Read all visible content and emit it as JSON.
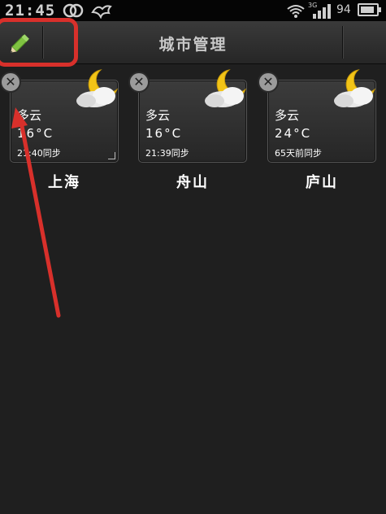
{
  "status_bar": {
    "time": "21:45",
    "network_label": "3G",
    "battery_level": "94",
    "icons": [
      "pair-of-rings-icon",
      "bird-icon",
      "wifi-icon",
      "signal-icon",
      "battery-icon"
    ]
  },
  "header": {
    "title": "城市管理",
    "edit_icon": "pencil-icon"
  },
  "cities": [
    {
      "name": "上海",
      "weather": "多云",
      "temp": "16°C",
      "sync": "21:40同步",
      "icon": "moon-cloud-icon"
    },
    {
      "name": "舟山",
      "weather": "多云",
      "temp": "16°C",
      "sync": "21:39同步",
      "icon": "moon-cloud-icon"
    },
    {
      "name": "庐山",
      "weather": "多云",
      "temp": "24°C",
      "sync": "65天前同步",
      "icon": "moon-cloud-icon"
    }
  ],
  "colors": {
    "annotation_red": "#d8302b",
    "pencil_green": "#7fc241",
    "background": "#1f1f1f"
  }
}
